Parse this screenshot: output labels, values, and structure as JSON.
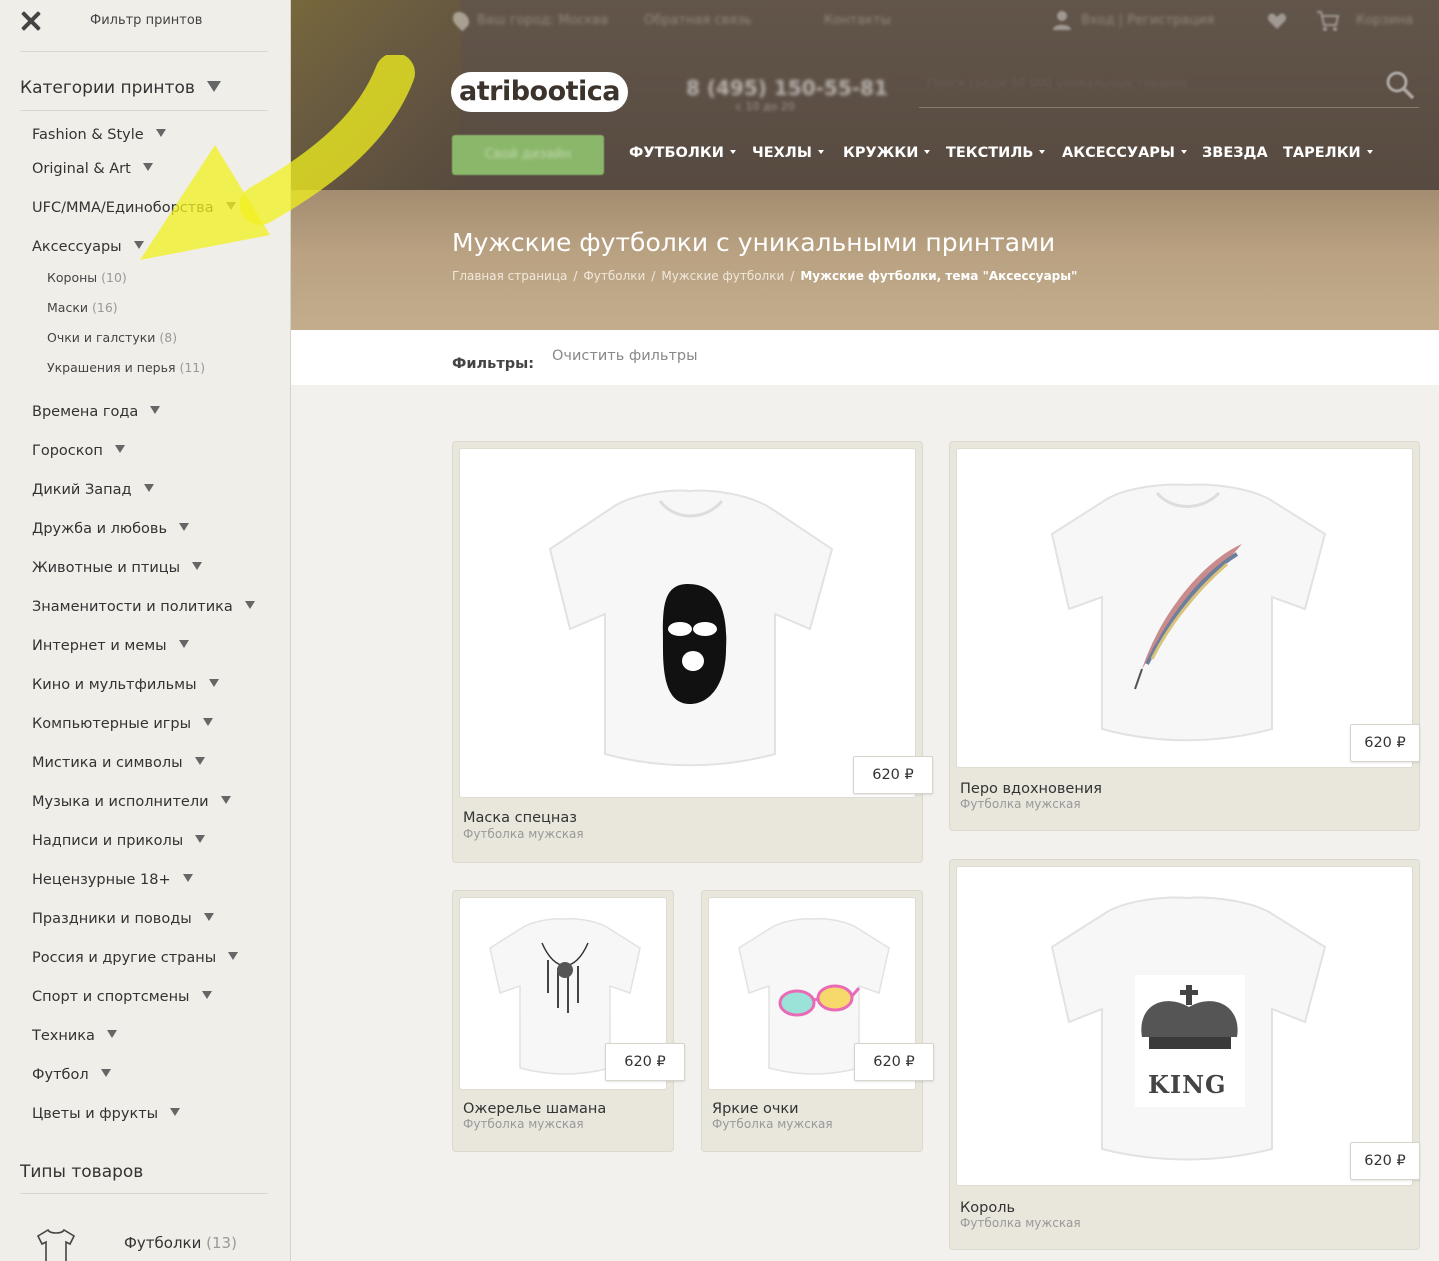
{
  "sidebar": {
    "header_title": "Фильтр принтов",
    "section_prints": "Категории принтов",
    "categories": [
      "Fashion & Style",
      "Original & Art",
      "UFC/MMA/Единоборства",
      "Аксессуары",
      "Времена года",
      "Гороскоп",
      "Дикий Запад",
      "Дружба и любовь",
      "Животные и птицы",
      "Знаменитости и политика",
      "Интернет и мемы",
      "Кино и мультфильмы",
      "Компьютерные игры",
      "Мистика и символы",
      "Музыка и исполнители",
      "Надписи и приколы",
      "Нецензурные 18+",
      "Праздники и поводы",
      "Россия и другие страны",
      "Спорт и спортсмены",
      "Техника",
      "Футбол",
      "Цветы и фрукты"
    ],
    "subcategories": [
      {
        "label": "Короны",
        "count": "(10)"
      },
      {
        "label": "Маски",
        "count": "(16)"
      },
      {
        "label": "Очки и галстуки",
        "count": "(8)"
      },
      {
        "label": "Украшения и перья",
        "count": "(11)"
      }
    ],
    "section_types": "Типы товаров",
    "product_type": {
      "label": "Футболки",
      "count": "(13)"
    }
  },
  "header": {
    "topbar": {
      "city": "Ваш город: Москва",
      "feedback": "Обратная связь",
      "contacts": "Контакты",
      "login": "Вход | Регистрация",
      "cart": "Корзина"
    },
    "logo": "atribootica",
    "phone": "8 (495) 150-55-81",
    "phone_sub": "с 10 до 20",
    "search_placeholder": "Поиск среди 50 000 уникальных товаров",
    "design_button": "Свой дизайн",
    "nav": [
      {
        "label": "ФУТБОЛКИ",
        "dropdown": true
      },
      {
        "label": "ЧЕХЛЫ",
        "dropdown": true
      },
      {
        "label": "КРУЖКИ",
        "dropdown": true
      },
      {
        "label": "ТЕКСТИЛЬ",
        "dropdown": true
      },
      {
        "label": "АКСЕССУАРЫ",
        "dropdown": true
      },
      {
        "label": "ЗВЕЗДА",
        "dropdown": false
      },
      {
        "label": "ТАРЕЛКИ",
        "dropdown": true
      }
    ]
  },
  "hero": {
    "title": "Мужские футболки с уникальными принтами",
    "breadcrumb": [
      "Главная страница",
      "Футболки",
      "Мужские футболки"
    ],
    "breadcrumb_current": "Мужские футболки, тема \"Аксессуары\""
  },
  "filters": {
    "label": "Фильтры:",
    "clear": "Очистить фильтры"
  },
  "products": [
    {
      "name": "Маска спецназ",
      "type": "Футболка мужская",
      "price": "620 ₽",
      "print": "balaclava"
    },
    {
      "name": "Перо вдохновения",
      "type": "Футболка мужская",
      "price": "620 ₽",
      "print": "feather"
    },
    {
      "name": "Ожерелье шамана",
      "type": "Футболка мужская",
      "price": "620 ₽",
      "print": "necklace"
    },
    {
      "name": "Яркие очки",
      "type": "Футболка мужская",
      "price": "620 ₽",
      "print": "glasses"
    },
    {
      "name": "Король",
      "type": "Футболка мужская",
      "price": "620 ₽",
      "print": "crown",
      "print_text": "KING"
    }
  ],
  "colors": {
    "accent_green": "#8bb76a",
    "header_brown": "#5b4e44",
    "sidebar_bg": "#f0eee9",
    "annotation_arrow": "#f2f01e"
  }
}
